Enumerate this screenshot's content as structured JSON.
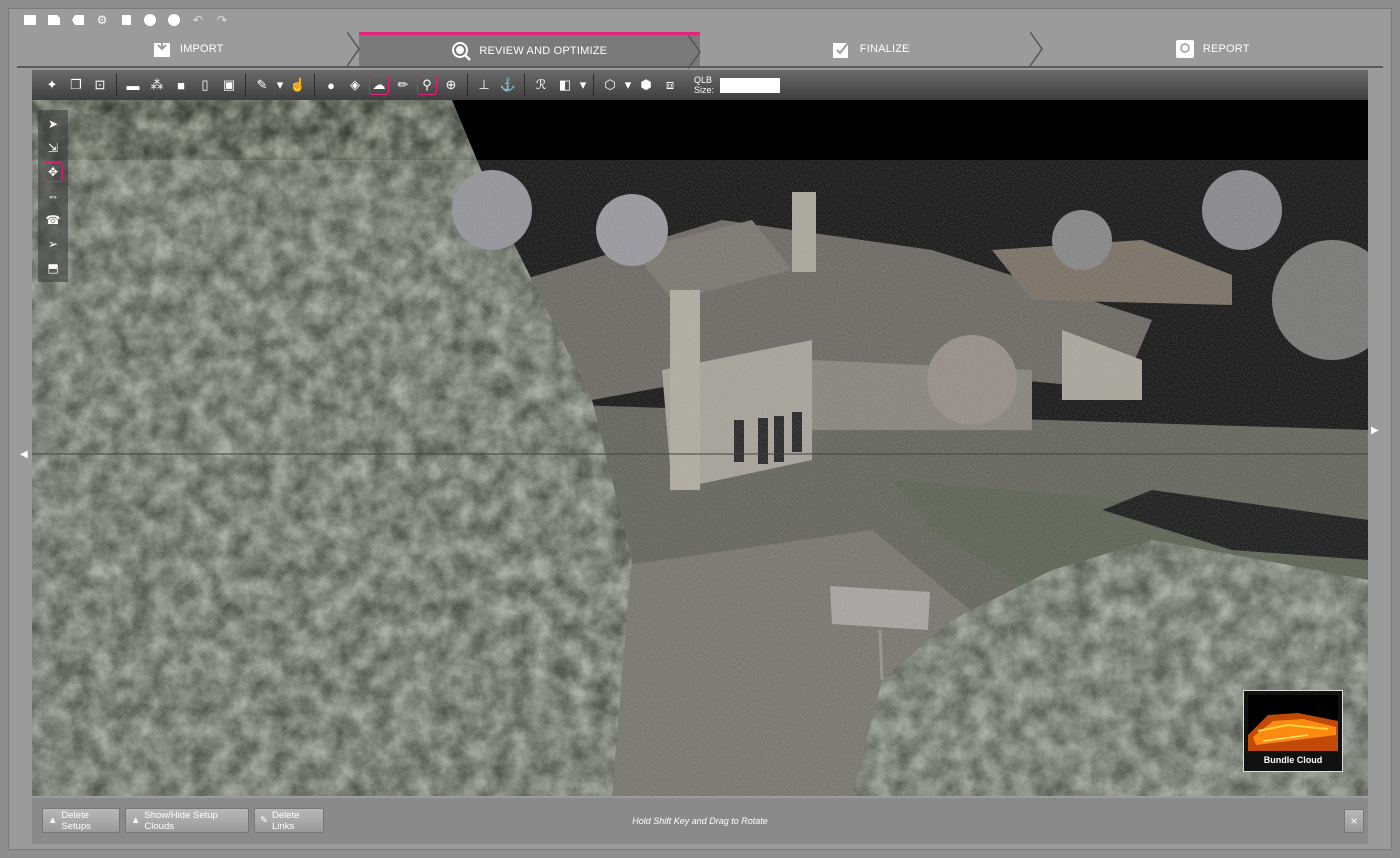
{
  "quickbar": {
    "icons": [
      "new-icon",
      "open-icon",
      "tag-icon",
      "gear-icon",
      "save-icon",
      "circle-icon",
      "circle-icon",
      "undo-icon",
      "redo-icon"
    ]
  },
  "steps": [
    {
      "label": "IMPORT",
      "icon": "import-icon"
    },
    {
      "label": "REVIEW AND OPTIMIZE",
      "icon": "magnifier-icon",
      "active": true
    },
    {
      "label": "FINALIZE",
      "icon": "finalize-icon"
    },
    {
      "label": "REPORT",
      "icon": "report-icon"
    }
  ],
  "toolbar": {
    "qlb_label": "QLB",
    "size_label": "Size:",
    "qlb_value": ""
  },
  "bundle": {
    "label": "Bundle Cloud"
  },
  "bottombar": {
    "delete_setups": "Delete Setups",
    "show_hide": "Show/Hide Setup Clouds",
    "delete_links": "Delete Links",
    "hint": "Hold Shift Key and Drag to Rotate",
    "close": "×"
  },
  "colors": {
    "accent": "#e0247a",
    "toolbar": "#4a4a4a",
    "chrome": "#9b9b9b"
  }
}
